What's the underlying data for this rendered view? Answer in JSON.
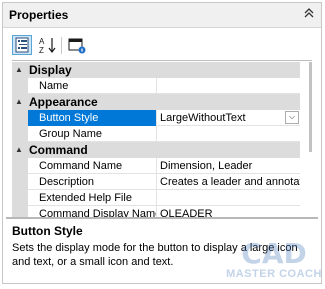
{
  "panel": {
    "title": "Properties",
    "collapse_icon": "double-chevron-up-icon"
  },
  "toolbar": {
    "categorized_icon": "categorized-list-icon",
    "alphabetical_icon": "sort-az-icon",
    "property_pages_icon": "property-pages-icon"
  },
  "grid": {
    "categories": [
      {
        "label": "Display",
        "toggle": "▲",
        "properties": [
          {
            "name": "Name",
            "value": ""
          }
        ]
      },
      {
        "label": "Appearance",
        "toggle": "▲",
        "properties": [
          {
            "name": "Button Style",
            "value": "LargeWithoutText",
            "selected": true,
            "dropdown": "⌵"
          },
          {
            "name": "Group Name",
            "value": ""
          }
        ]
      },
      {
        "label": "Command",
        "toggle": "▲",
        "properties": [
          {
            "name": "Command Name",
            "value": "Dimension, Leader"
          },
          {
            "name": "Description",
            "value": "Creates a leader and annotati"
          },
          {
            "name": "Extended Help File",
            "value": ""
          },
          {
            "name": "Command Display Name",
            "value": "QLEADER"
          }
        ]
      }
    ]
  },
  "help": {
    "title": "Button Style",
    "description": "Sets the display mode for the button to display a large icon and text, or a small icon and text."
  },
  "watermark": {
    "line1": "CAD",
    "line2": "MASTER COACH",
    "color": "#3b6fb6"
  },
  "colors": {
    "selection": "#0078d7",
    "category_bg": "#dcdcdc",
    "toolbar_active": "#cde6f7"
  }
}
